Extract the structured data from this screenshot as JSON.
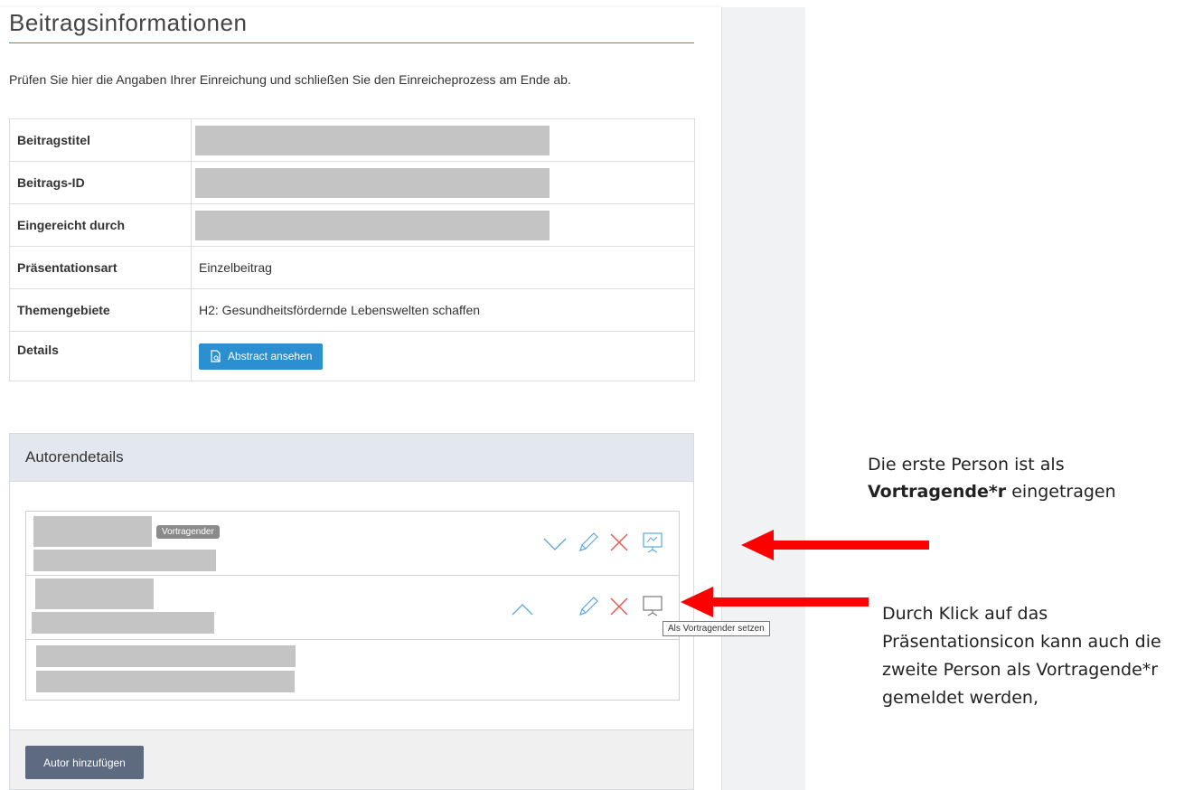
{
  "page": {
    "title": "Beitragsinformationen",
    "intro": "Prüfen Sie hier die Angaben Ihrer Einreichung und schließen Sie den Einreicheprozess am Ende ab."
  },
  "info_table": {
    "rows": [
      {
        "label": "Beitragstitel",
        "value": "",
        "redacted": true
      },
      {
        "label": "Beitrags-ID",
        "value": "",
        "redacted": true
      },
      {
        "label": "Eingereicht durch",
        "value": "",
        "redacted": true
      },
      {
        "label": "Präsentationsart",
        "value": "Einzelbeitrag"
      },
      {
        "label": "Themengebiete",
        "value": "H2: Gesundheitsfördernde Lebenswelten schaffen"
      },
      {
        "label": "Details",
        "button_label": "Abstract ansehen",
        "button_icon": "document-search-icon"
      }
    ]
  },
  "authors": {
    "heading": "Autorendetails",
    "presenter_badge": "Vortragender",
    "tooltip": "Als Vortragender setzen",
    "add_button": "Autor hinzufügen",
    "row_icons": [
      "chevron-down-icon",
      "chevron-up-icon",
      "pencil-icon",
      "close-icon",
      "presentation-icon"
    ]
  },
  "colors": {
    "accent_blue": "#2c8fd0",
    "delete_red": "#e8534a",
    "arrow_red": "#ff0000",
    "header_bg": "#e3e8ef",
    "button_slate": "#5d6a80",
    "redaction_gray": "#c4c4c4"
  },
  "annotations": {
    "note1_pre": "Die erste Person ist als ",
    "note1_bold": "Vortragende*r",
    "note1_post": " eingetragen",
    "note2": "Durch Klick auf das Präsentationsicon kann auch die zweite Person als Vortragende*r gemeldet werden,"
  }
}
